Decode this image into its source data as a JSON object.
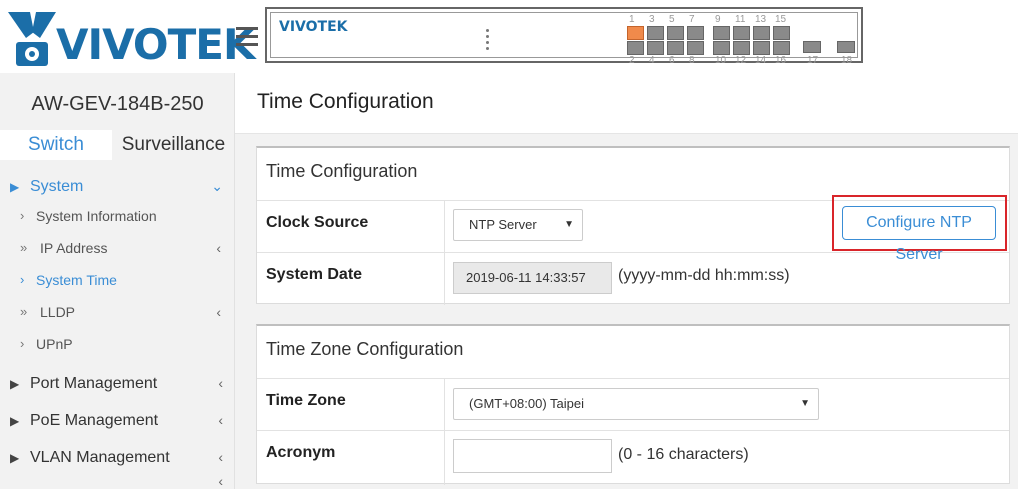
{
  "brand": {
    "logo_text": "VIVOTEK",
    "mini_logo_text": "VIVOTEK"
  },
  "device_panel": {
    "top_port_numbers": [
      "1",
      "3",
      "5",
      "7",
      "9",
      "11",
      "13",
      "15"
    ],
    "bottom_port_numbers": [
      "2",
      "4",
      "6",
      "8",
      "10",
      "12",
      "14",
      "16",
      "17",
      "18"
    ],
    "active_port": "1"
  },
  "sidebar": {
    "model": "AW-GEV-184B-250",
    "tabs": [
      {
        "label": "Switch"
      },
      {
        "label": "Surveillance"
      }
    ],
    "system": {
      "label": "System"
    },
    "sub_items": [
      {
        "label": "System Information"
      },
      {
        "label": "IP Address"
      },
      {
        "label": "System Time"
      },
      {
        "label": "LLDP"
      },
      {
        "label": "UPnP"
      }
    ],
    "items": [
      {
        "label": "Port Management"
      },
      {
        "label": "PoE Management"
      },
      {
        "label": "VLAN Management"
      }
    ]
  },
  "page": {
    "title": "Time Configuration"
  },
  "time_config": {
    "title": "Time Configuration",
    "clock_source_label": "Clock Source",
    "clock_source_value": "NTP Server",
    "configure_ntp_label": "Configure NTP Server",
    "system_date_label": "System Date",
    "system_date_value": "2019-06-11 14:33:57",
    "system_date_hint": "(yyyy-mm-dd hh:mm:ss)"
  },
  "timezone_config": {
    "title": "Time Zone Configuration",
    "time_zone_label": "Time Zone",
    "time_zone_value": "(GMT+08:00) Taipei",
    "acronym_label": "Acronym",
    "acronym_value": "",
    "acronym_hint": "(0 - 16 characters)"
  },
  "colors": {
    "accent": "#3a8dd5",
    "brand": "#1b6ea8",
    "highlight": "#d9252a",
    "active_port": "#f08a4b"
  }
}
